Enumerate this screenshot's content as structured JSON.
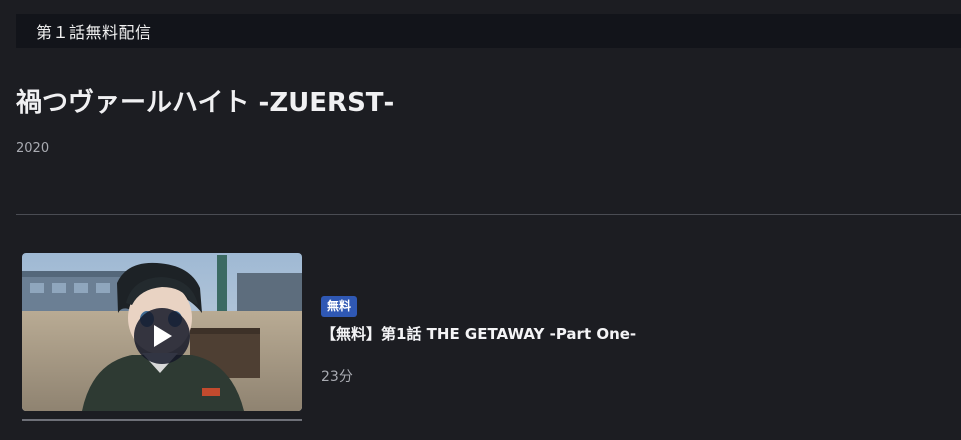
{
  "banner": {
    "label": "第１話無料配信"
  },
  "series": {
    "title": "禍つヴァールハイト ‐ZUERST‐",
    "year": "2020"
  },
  "episodes": [
    {
      "badge": "無料",
      "title": "【無料】第1話 THE GETAWAY -Part One-",
      "duration": "23分",
      "play_icon": "play-icon"
    }
  ],
  "colors": {
    "background": "#1c1d22",
    "banner_bg": "#12141a",
    "badge_bg": "#2f58b4",
    "muted_text": "#a9abb2"
  }
}
